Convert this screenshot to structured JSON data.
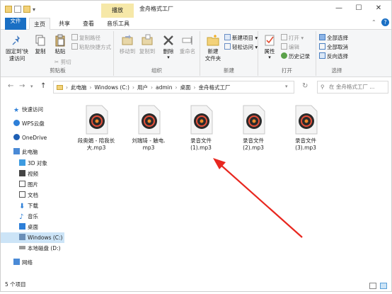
{
  "titlebar": {
    "tools_tab": "播放",
    "title": "金舟格式工厂",
    "minimize": "—",
    "maximize": "☐",
    "close": "✕"
  },
  "tabs": {
    "file": "文件",
    "home": "主页",
    "share": "共享",
    "view": "查看",
    "music_tools": "音乐工具"
  },
  "ribbon": {
    "clipboard": {
      "label": "剪贴板",
      "pin": "固定到快速访问",
      "pin_l1": "固定到'快",
      "pin_l2": "速访问",
      "copy": "复制",
      "paste": "粘贴",
      "copy_path": "复制路径",
      "paste_shortcut": "粘贴快捷方式",
      "cut": "剪切"
    },
    "organize": {
      "label": "组织",
      "move_to": "移动到",
      "copy_to": "复制到",
      "delete": "删除",
      "rename": "重命名"
    },
    "new": {
      "label": "新建",
      "new_folder_l1": "新建",
      "new_folder_l2": "文件夹",
      "new_item": "新建项目",
      "easy_access": "轻松访问"
    },
    "open": {
      "label": "打开",
      "properties": "属性",
      "open": "打开",
      "edit": "编辑",
      "history": "历史记录"
    },
    "select": {
      "label": "选择",
      "select_all": "全部选择",
      "select_none": "全部取消",
      "invert": "反向选择"
    }
  },
  "address": {
    "path": [
      "此电脑",
      "Windows (C:)",
      "用户",
      "admin",
      "桌面",
      "金舟格式工厂"
    ],
    "separator": "›",
    "search_placeholder": "在 金舟格式工厂 ..."
  },
  "nav": {
    "items": [
      {
        "label": "快速访问"
      },
      {
        "label": "WPS云盘"
      },
      {
        "label": "OneDrive"
      },
      {
        "label": "此电脑"
      },
      {
        "label": "3D 对象"
      },
      {
        "label": "视频"
      },
      {
        "label": "图片"
      },
      {
        "label": "文档"
      },
      {
        "label": "下载"
      },
      {
        "label": "音乐"
      },
      {
        "label": "桌面"
      },
      {
        "label": "Windows (C:)"
      },
      {
        "label": "本地磁盘 (D:)"
      },
      {
        "label": "网络"
      }
    ]
  },
  "files": [
    {
      "line1": "段奥娟 - 陪我长",
      "line2": "大.mp3"
    },
    {
      "line1": "刘瑞琦 - 触电.",
      "line2": "mp3"
    },
    {
      "line1": "录音文件",
      "line2": "(1).mp3"
    },
    {
      "line1": "录音文件",
      "line2": "(2).mp3"
    },
    {
      "line1": "录音文件",
      "line2": "(3).mp3"
    }
  ],
  "status": {
    "count": "5 个项目"
  },
  "colors": {
    "accent": "#1a6fc4",
    "tools_tab": "#f6e8a8",
    "selected": "#cce4f7",
    "arrow": "#e8271f"
  }
}
